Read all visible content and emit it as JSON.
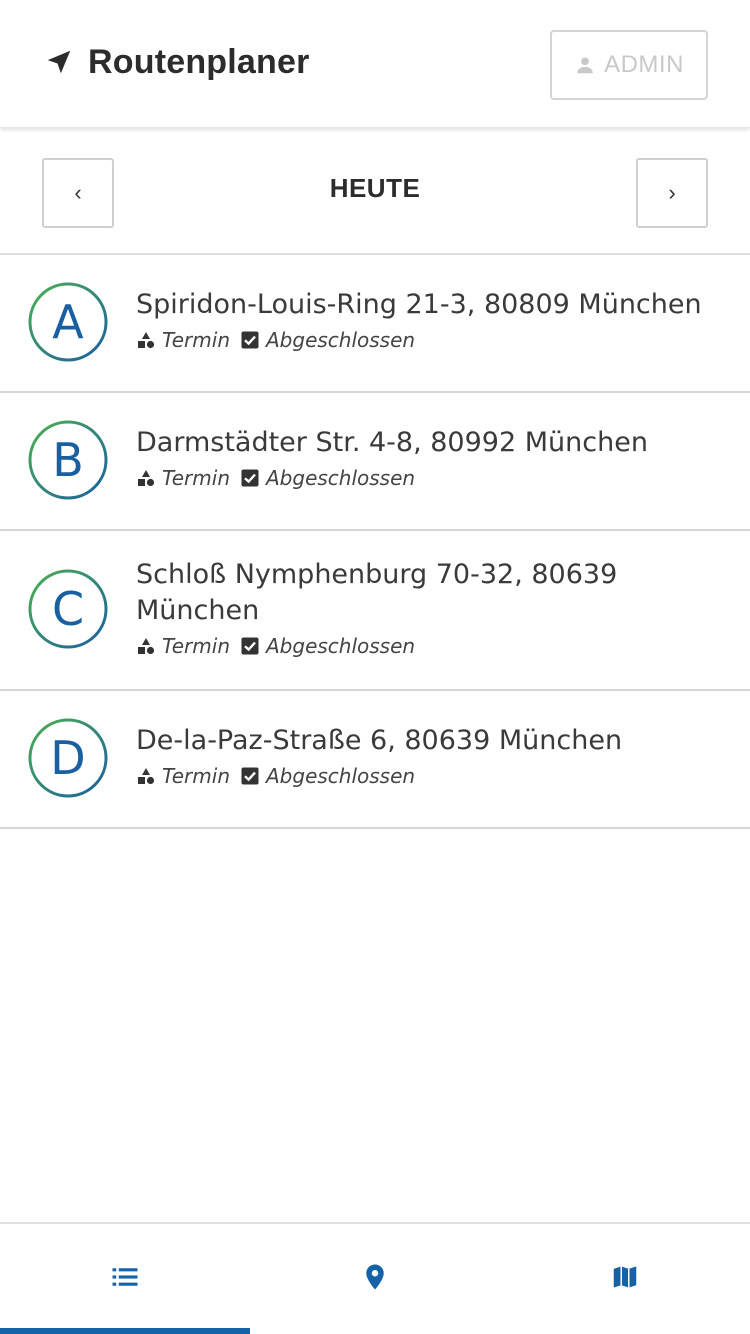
{
  "header": {
    "title": "Routenplaner",
    "brand_icon": "navigation-arrow-icon",
    "admin_button": {
      "label": "ADMIN",
      "icon": "person-icon",
      "disabled": true
    }
  },
  "date_nav": {
    "prev_label": "‹",
    "next_label": "›",
    "current_label": "HEUTE"
  },
  "stops": [
    {
      "letter": "A",
      "address": "Spiridon-Louis-Ring 21-3, 80809 München",
      "type_label": "Termin",
      "status_label": "Abgeschlossen"
    },
    {
      "letter": "B",
      "address": "Darmstädter Str. 4-8, 80992 München",
      "type_label": "Termin",
      "status_label": "Abgeschlossen"
    },
    {
      "letter": "C",
      "address": "Schloß Nymphenburg 70-32, 80639 München",
      "type_label": "Termin",
      "status_label": "Abgeschlossen"
    },
    {
      "letter": "D",
      "address": "De-la-Paz-Straße 6, 80639 München",
      "type_label": "Termin",
      "status_label": "Abgeschlossen"
    }
  ],
  "bottom_nav": {
    "tabs": [
      {
        "icon": "list-icon",
        "active": true
      },
      {
        "icon": "map-pin-icon",
        "active": false
      },
      {
        "icon": "map-icon",
        "active": false
      }
    ]
  },
  "colors": {
    "accent": "#1463a8",
    "badge_green": "#4caf50",
    "badge_blue": "#1a5fa0",
    "disabled": "#c8c8c8"
  }
}
